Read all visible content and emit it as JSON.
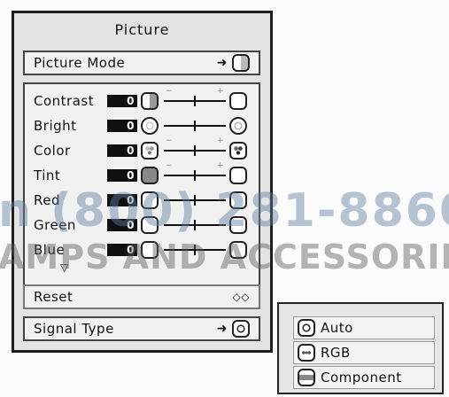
{
  "menu": {
    "title": "Picture",
    "picture_mode_label": "Picture Mode",
    "adjustments": [
      {
        "label": "Contrast",
        "value": "0",
        "icon": "contrast-icon"
      },
      {
        "label": "Bright",
        "value": "0",
        "icon": "brightness-icon"
      },
      {
        "label": "Color",
        "value": "0",
        "icon": "color-icon"
      },
      {
        "label": "Tint",
        "value": "0",
        "icon": "tint-icon"
      },
      {
        "label": "Red",
        "value": "0",
        "icon": "red-icon"
      },
      {
        "label": "Green",
        "value": "0",
        "icon": "green-icon"
      },
      {
        "label": "Blue",
        "value": "0",
        "icon": "blue-icon"
      }
    ],
    "slider_minus": "−",
    "slider_plus": "+",
    "more_indicator": "▽",
    "reset_label": "Reset",
    "signal_type_label": "Signal Type",
    "arrow": "➜"
  },
  "signal_options": [
    {
      "label": "Auto",
      "icon": "auto-signal-icon"
    },
    {
      "label": "RGB",
      "icon": "rgb-icon"
    },
    {
      "label": "Component",
      "icon": "component-icon"
    }
  ],
  "watermark": {
    "phone": "n (800) 281-8860",
    "company": "AMPS AND ACCESSORIES"
  }
}
